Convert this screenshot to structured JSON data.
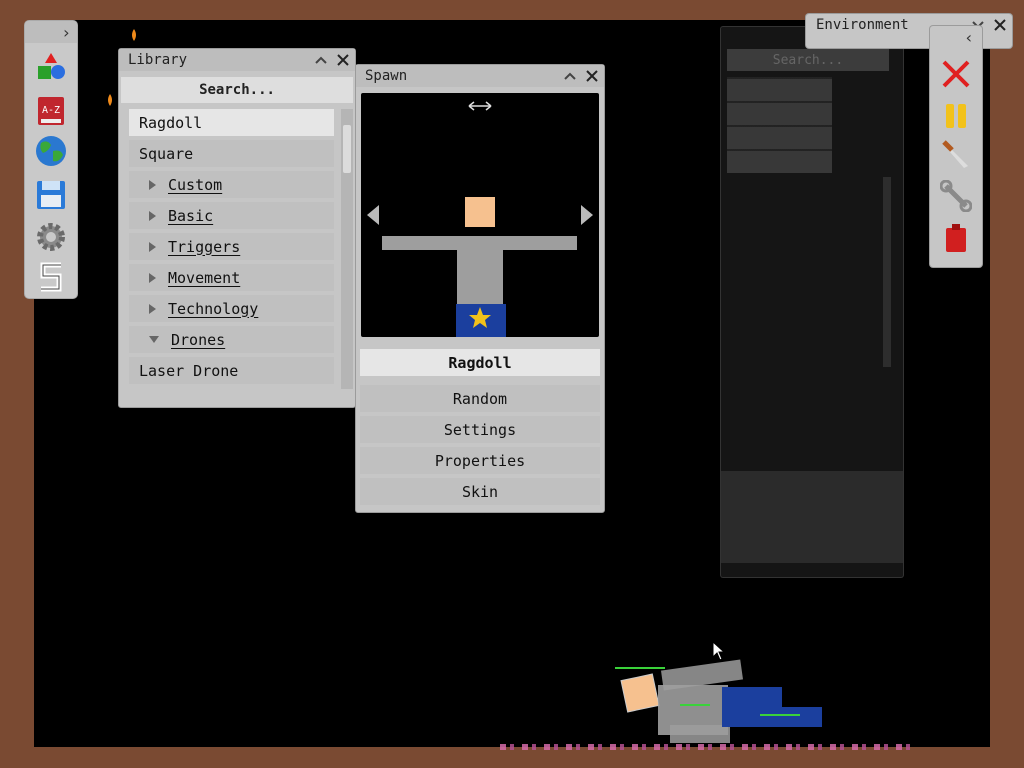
{
  "library": {
    "title": "Library",
    "search_label": "Search...",
    "items": [
      {
        "label": "Ragdoll",
        "selected": true,
        "kind": "item"
      },
      {
        "label": "Square",
        "selected": false,
        "kind": "item"
      },
      {
        "label": "Custom",
        "kind": "folder",
        "expanded": false
      },
      {
        "label": "Basic",
        "kind": "folder",
        "expanded": false
      },
      {
        "label": "Triggers",
        "kind": "folder",
        "expanded": false
      },
      {
        "label": "Movement",
        "kind": "folder",
        "expanded": false
      },
      {
        "label": "Technology",
        "kind": "folder",
        "expanded": false
      },
      {
        "label": "Drones",
        "kind": "folder",
        "expanded": true
      },
      {
        "label": "Laser Drone",
        "kind": "item"
      }
    ]
  },
  "spawn": {
    "title": "Spawn",
    "selected_name": "Ragdoll",
    "buttons": [
      "Random",
      "Settings",
      "Properties",
      "Skin"
    ]
  },
  "environment": {
    "title": "Environment"
  },
  "ghost_library": {
    "search_label": "Search..."
  },
  "left_toolbar_icons": [
    "expand-arrow-icon",
    "shapes-icon",
    "dictionary-icon",
    "globe-icon",
    "save-icon",
    "settings-gear-icon",
    "scripting-icon"
  ],
  "right_toolbar_icons": [
    "delete-icon",
    "pause-icon",
    "knife-icon",
    "wrench-icon",
    "fuel-can-icon"
  ],
  "colors": {
    "frame": "#7a4a32",
    "panel": "#c6c6c6",
    "ragdoll_skin": "#f6c18f",
    "ragdoll_body": "#9e9e9e",
    "ragdoll_pants": "#1b3f9e",
    "star": "#f2c21b"
  }
}
